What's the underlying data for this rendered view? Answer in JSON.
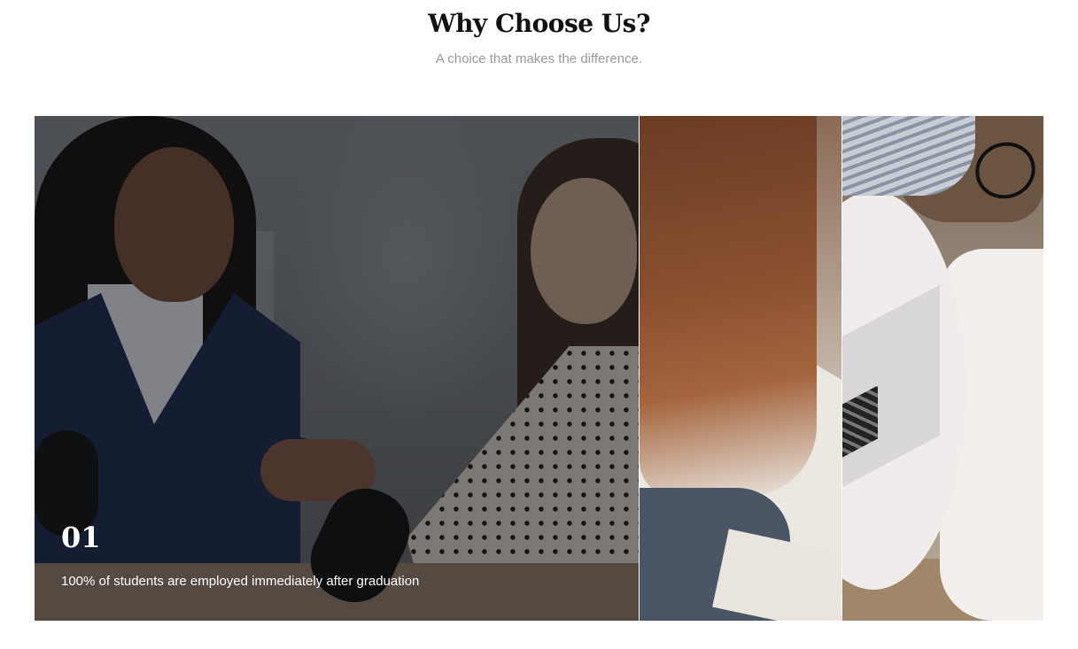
{
  "section": {
    "title": "Why Choose Us?",
    "subtitle": "A choice that makes the difference."
  },
  "gallery": {
    "panels": [
      {
        "number": "01",
        "caption": "100% of students are employed immediately after graduation",
        "active": true
      },
      {
        "active": false
      },
      {
        "active": false
      }
    ]
  },
  "colors": {
    "title": "#111111",
    "subtitle": "#9a9a9a",
    "overlay_text": "#ffffff",
    "background": "#ffffff"
  }
}
